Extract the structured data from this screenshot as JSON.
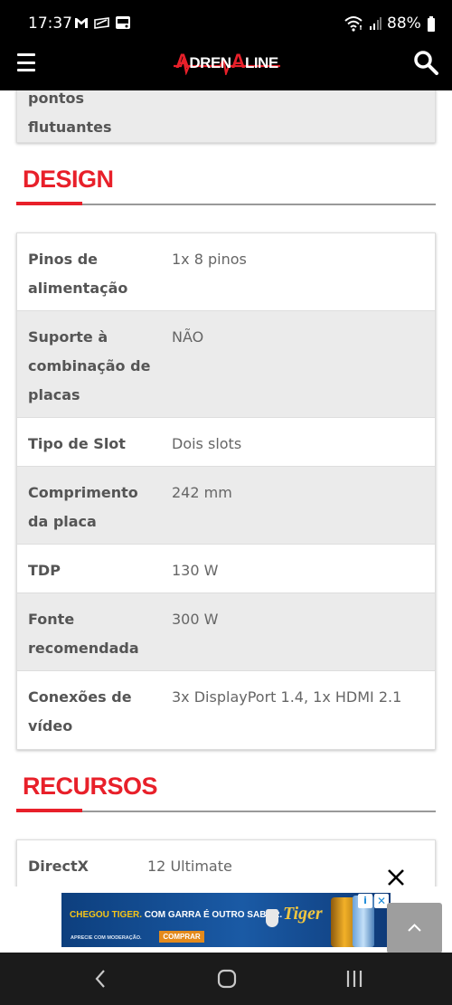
{
  "status_bar": {
    "time": "17:37",
    "battery": "88%"
  },
  "header": {
    "logo_text": "ADRENALINE",
    "logo_first": "A",
    "logo_mid": "DREN",
    "logo_a2": "A",
    "logo_end": "LINE"
  },
  "prev_table": {
    "rows": [
      {
        "key_line1": "pontos",
        "key_line2": "flutuantes"
      }
    ]
  },
  "sections": {
    "design": {
      "title": "DESIGN",
      "rows": [
        {
          "key": "Pinos de alimentação",
          "value": "1x 8 pinos"
        },
        {
          "key": "Suporte à combinação de placas",
          "value": "NÃO"
        },
        {
          "key": "Tipo de Slot",
          "value": "Dois slots"
        },
        {
          "key": "Comprimento da placa",
          "value": "242 mm"
        },
        {
          "key": "TDP",
          "value": "130 W"
        },
        {
          "key": "Fonte recomendada",
          "value": "300 W"
        },
        {
          "key": "Conexões de vídeo",
          "value": "3x DisplayPort 1.4, 1x HDMI 2.1"
        }
      ]
    },
    "recursos": {
      "title": "RECURSOS",
      "rows": [
        {
          "key": "DirectX",
          "value": "12 Ultimate"
        }
      ]
    }
  },
  "ad": {
    "headline_yellow": "CHEGOU TIGER.",
    "headline_white": " COM GARRA É OUTRO SABOR.",
    "button": "COMPRAR",
    "disclaimer": "APRECIE COM MODERAÇÃO.",
    "brand": "Tiger",
    "info_glyph": "i",
    "close_glyph": "✕"
  },
  "colors": {
    "accent_red": "#e8202a",
    "header_bg": "#000000",
    "row_gray": "#ebebeb",
    "scroll_btn": "#9e9e9e",
    "nav_bg": "#1b1b1b"
  },
  "icons": {
    "menu": "hamburger-menu-icon",
    "search": "search-icon",
    "close_ad": "close-icon",
    "scroll_top": "chevron-up-icon",
    "nav_back": "back-icon",
    "nav_home": "home-icon",
    "nav_recents": "recents-icon"
  }
}
